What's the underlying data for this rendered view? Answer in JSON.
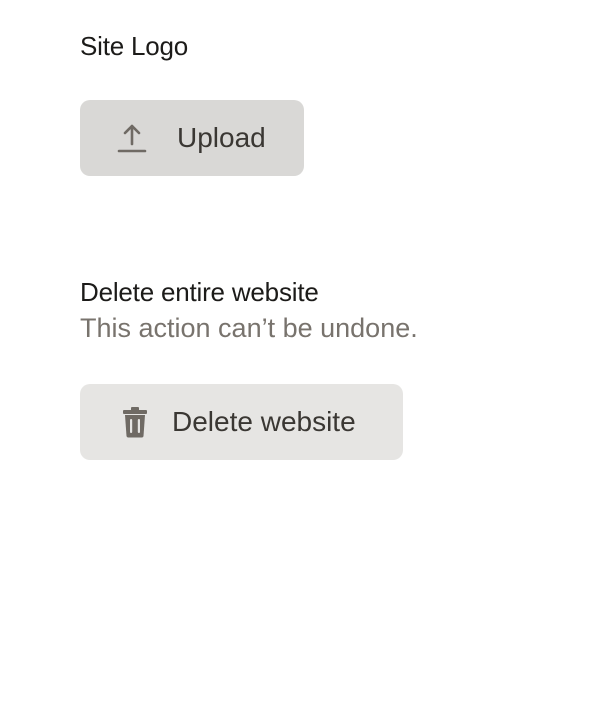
{
  "site_logo": {
    "heading": "Site Logo",
    "upload_button": {
      "label": "Upload",
      "icon": "upload-icon"
    }
  },
  "delete_site": {
    "heading": "Delete entire website",
    "description": "This action can’t be undone.",
    "delete_button": {
      "label": "Delete website",
      "icon": "trash-icon"
    }
  },
  "colors": {
    "heading_text": "#1c1b19",
    "muted_text": "#78736d",
    "upload_button_bg": "#d9d8d6",
    "delete_button_bg": "#e6e5e3",
    "icon": "#6f6a64"
  }
}
